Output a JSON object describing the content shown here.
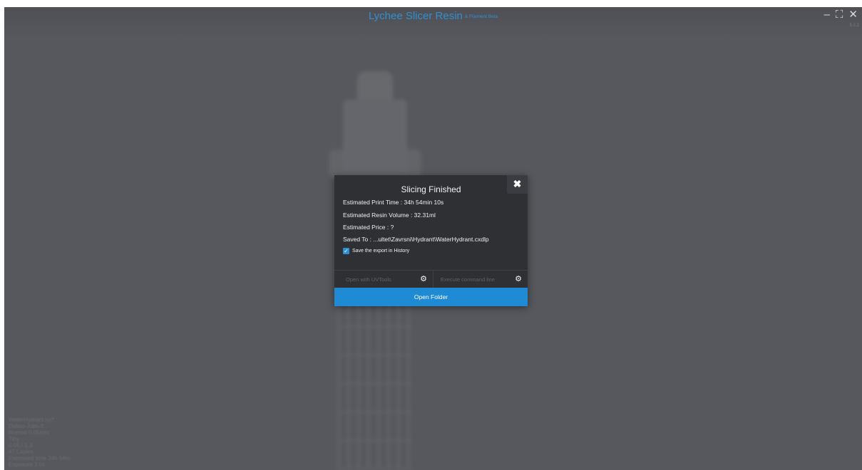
{
  "app": {
    "title": "Lychee Slicer Resin",
    "title_suffix": "& Filament Beta",
    "version": "5.2.2",
    "accent_color": "#2f90d0",
    "window_controls": {
      "minimize": "–",
      "maximize": "⛶",
      "close": "✕"
    }
  },
  "info_panel": {
    "lines": [
      "WaterHydrant.lyc*",
      "Dalieo-Jobs-ff...",
      "Normal 0.05mm",
      "Tiny",
      "0.05 / 1.3",
      "47 Layers",
      "Estimated time 34h 54m",
      "Exposure 3.0s"
    ]
  },
  "modal": {
    "title": "Slicing Finished",
    "close_icon": "close-icon",
    "stats": {
      "print_time": "Estimated Print Time : 34h 54min 10s",
      "resin_volume": "Estimated Resin Volume : 32.31ml",
      "price": "Estimated Price : ?",
      "saved_to": "Saved To : ...ultet\\Zavrsni\\Hydrant\\WaterHydrant.cxdlp"
    },
    "save_history": {
      "label": "Save the export in History",
      "checked": true,
      "check_glyph": "✓"
    },
    "actions": {
      "uvtools_label": "Open with UVTools",
      "command_label": "Execute command line",
      "gear_glyph": "⚙"
    },
    "open_folder_label": "Open Folder",
    "button_color": "#1f8bd4"
  }
}
